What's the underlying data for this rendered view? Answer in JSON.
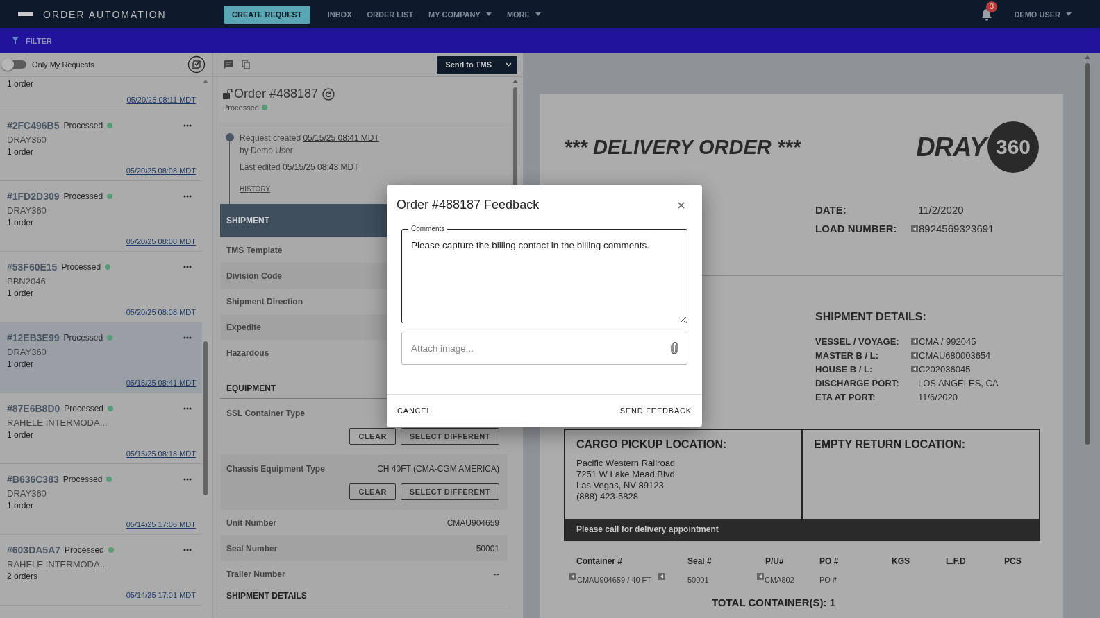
{
  "app": {
    "title": "ORDER AUTOMATION"
  },
  "nav": {
    "create_button": "CREATE REQUEST",
    "items": [
      {
        "label": "INBOX",
        "dropdown": false
      },
      {
        "label": "ORDER LIST",
        "dropdown": false
      },
      {
        "label": "MY COMPANY",
        "dropdown": true
      },
      {
        "label": "MORE",
        "dropdown": true
      }
    ],
    "notifications": "3",
    "user": "DEMO USER"
  },
  "filter": {
    "label": "FILTER"
  },
  "requests": {
    "toggle": {
      "label": "Only My Requests",
      "on": false
    },
    "items": [
      {
        "orders": "1 order",
        "date": "05/20/25 08:11 MDT",
        "selected": false
      },
      {
        "id": "#2FC496B5",
        "status": "Processed",
        "color": "#5a9a78",
        "source": "DRAY360",
        "orders": "1 order",
        "date": "05/20/25 08:08 MDT",
        "selected": false
      },
      {
        "id": "#1FD2D309",
        "status": "Processed",
        "color": "#5a9a78",
        "source": "DRAY360",
        "orders": "1 order",
        "date": "05/20/25 08:08 MDT",
        "selected": false
      },
      {
        "id": "#53F60E15",
        "status": "Processed",
        "color": "#5a9a78",
        "source": "PBN2046",
        "orders": "1 order",
        "date": "05/20/25 08:08 MDT",
        "selected": false
      },
      {
        "id": "#12EB3E99",
        "status": "Processed",
        "color": "#5a9a78",
        "source": "DRAY360",
        "orders": "1 order",
        "date": "05/15/25 08:41 MDT",
        "selected": true
      },
      {
        "id": "#87E6B8D0",
        "status": "Processed",
        "color": "#5a9a78",
        "source": "RAHELE INTERMODA...",
        "orders": "1 order",
        "date": "05/15/25 08:18 MDT",
        "selected": false
      },
      {
        "id": "#B636C383",
        "status": "Processed",
        "color": "#5a9a78",
        "source": "DRAY360",
        "orders": "1 order",
        "date": "05/14/25 17:06 MDT",
        "selected": false
      },
      {
        "id": "#603DA5A7",
        "status": "Processed",
        "color": "#5a9a78",
        "source": "RAHELE INTERMODA...",
        "orders": "2 orders",
        "date": "05/14/25 17:01 MDT",
        "selected": false
      }
    ]
  },
  "order": {
    "send_button": "Send to TMS",
    "title": "Order #488187",
    "status": "Processed",
    "created_label": "Request created",
    "created_date": "05/15/25 08:41 MDT",
    "created_by": "by Demo User",
    "edited_label": "Last edited",
    "edited_date": "05/15/25 08:43 MDT",
    "history": "HISTORY",
    "sections": [
      {
        "title": "SHIPMENT",
        "rows": [
          {
            "label": "TMS Template"
          },
          {
            "label": "Division Code"
          },
          {
            "label": "Shipment Direction"
          },
          {
            "label": "Expedite"
          },
          {
            "label": "Hazardous"
          }
        ]
      },
      {
        "title": "EQUIPMENT",
        "rows": [
          {
            "label": "SSL Container Type",
            "buttons": [
              "CLEAR",
              "SELECT DIFFERENT"
            ]
          },
          {
            "label": "Chassis Equipment Type",
            "value": "CH 40FT (CMA-CGM AMERICA)",
            "buttons": [
              "CLEAR",
              "SELECT DIFFERENT"
            ]
          },
          {
            "label": "Unit Number",
            "value": "CMAU904659"
          },
          {
            "label": "Seal Number",
            "value": "50001"
          },
          {
            "label": "Trailer Number",
            "value": "--"
          }
        ]
      },
      {
        "title": "SHIPMENT DETAILS"
      }
    ]
  },
  "document": {
    "title": "*** DELIVERY ORDER ***",
    "logo_word": "DRAY",
    "logo_number": "360",
    "header_fields": [
      {
        "label": "DATE:",
        "value": "11/2/2020",
        "flag": false
      },
      {
        "label": "LOAD NUMBER:",
        "value": "8924569323691",
        "flag": true
      }
    ],
    "details_title": "SHIPMENT DETAILS:",
    "details": [
      {
        "label": "VESSEL / VOYAGE:",
        "value": "CMA / 992045",
        "flag": true
      },
      {
        "label": "MASTER B / L:",
        "value": "CMAU680003654",
        "flag": true
      },
      {
        "label": "HOUSE B / L:",
        "value": "C202036045",
        "flag": true
      },
      {
        "label": "DISCHARGE PORT:",
        "value": "LOS ANGELES, CA",
        "flag": false
      },
      {
        "label": "ETA  AT PORT:",
        "value": "11/6/2020",
        "flag": false
      }
    ],
    "pickup": {
      "title": "CARGO PICKUP LOCATION:",
      "lines": [
        "Pacific Western Railroad",
        "7251 W Lake Mead Blvd",
        "Las Vegas, NV 89123",
        "(888) 423-5828"
      ]
    },
    "return": {
      "title": "EMPTY RETURN LOCATION:"
    },
    "notice": "Please call for delivery appointment",
    "columns": [
      "Container #",
      "Seal #",
      "P/U#",
      "PO #",
      "KGS",
      "L.F.D",
      "PCS"
    ],
    "row": [
      {
        "value": "CMAU904659 / 40 FT",
        "flag": true,
        "flag_after": true
      },
      {
        "value": "50001",
        "flag": false,
        "flag_after": false
      },
      {
        "value": "CMA802",
        "flag": true,
        "flag_after": false
      },
      {
        "value": "PO #",
        "flag": false,
        "flag_after": false
      }
    ],
    "total": "TOTAL CONTAINER(S): 1"
  },
  "modal": {
    "title": "Order #488187 Feedback",
    "comments_label": "Comments",
    "comments": "Please capture the billing contact in the billing comments.",
    "attach_placeholder": "Attach image...",
    "cancel": "CANCEL",
    "send": "SEND FEEDBACK"
  }
}
